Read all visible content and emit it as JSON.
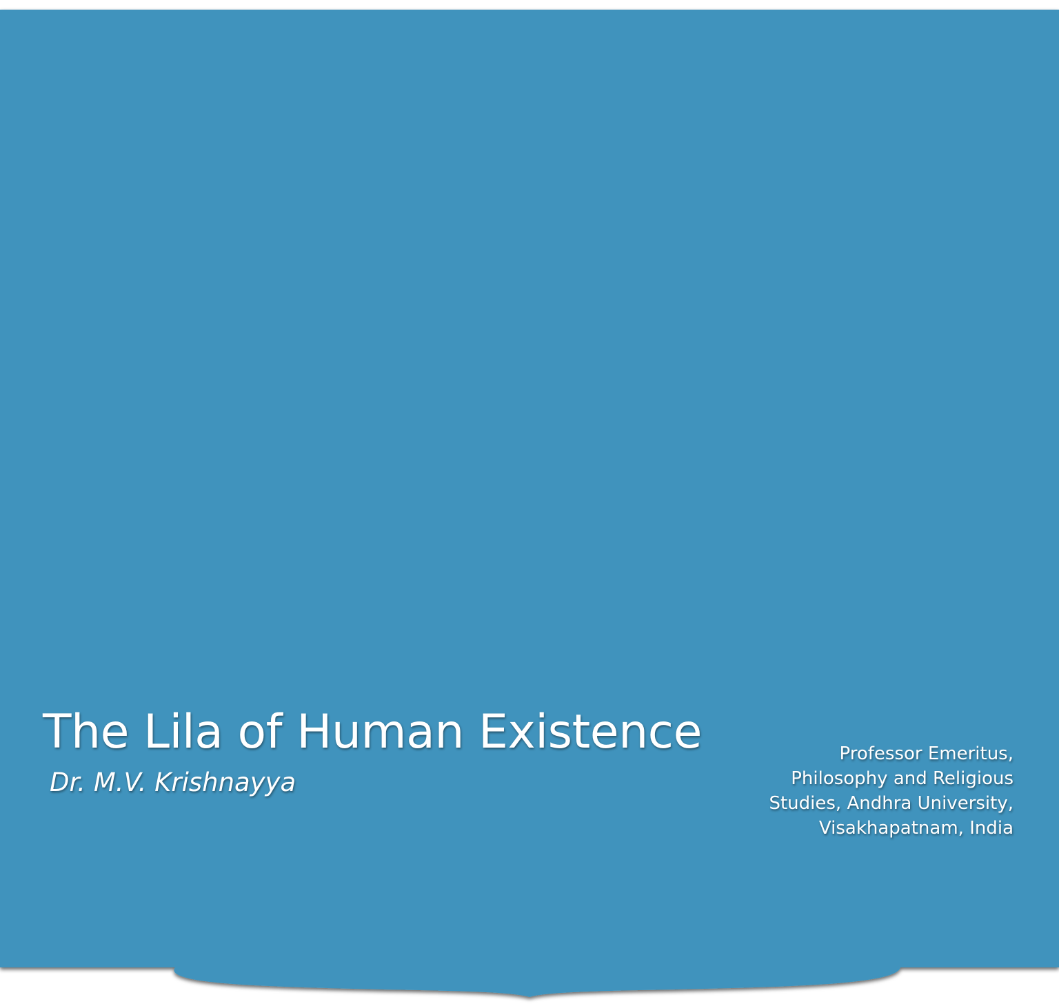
{
  "colors": {
    "hero_background": "#4193bd",
    "text": "#ffffff"
  },
  "hero": {
    "title": "The Lila of Human Existence",
    "author": "Dr. M.V. Krishnayya",
    "affiliation_lines": [
      "Professor Emeritus,",
      "Philosophy and Religious",
      "Studies, Andhra University,",
      "Visakhapatnam, India"
    ]
  }
}
